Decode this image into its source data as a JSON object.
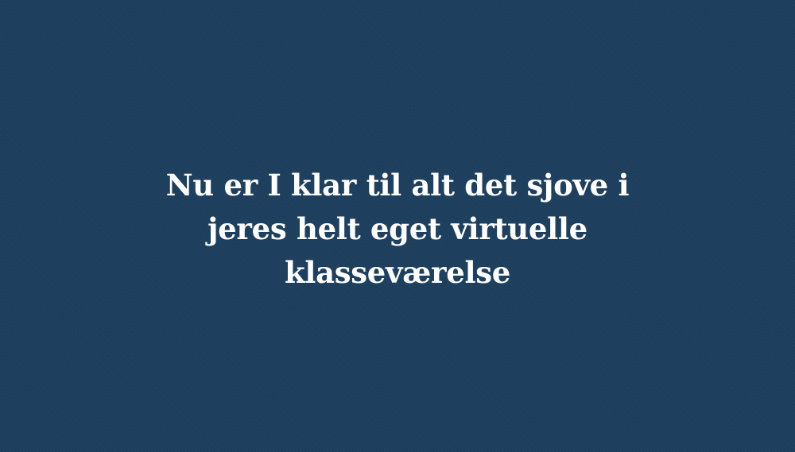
{
  "slide": {
    "background_color": "#1d3f5e",
    "text_color": "#ffffff",
    "message": "Nu er I klar til alt det sjove i jeres helt eget virtuelle klasseværelse"
  }
}
